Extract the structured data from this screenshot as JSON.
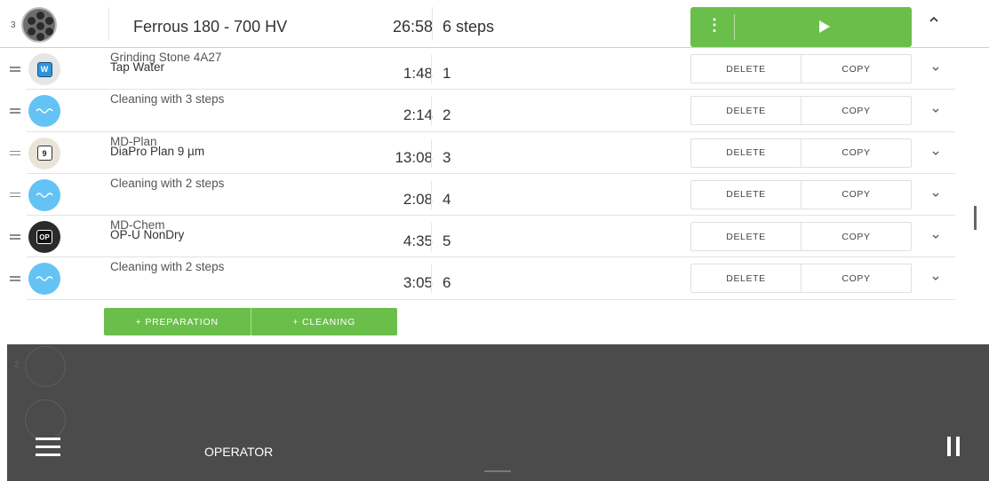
{
  "header": {
    "holder_number": "3",
    "title": "Ferrous 180 - 700 HV",
    "total_time": "26:58",
    "step_count": "6 steps",
    "kebab_glyph": "⋮",
    "run_color": "#6abf4b"
  },
  "steps": [
    {
      "line1": "Grinding Stone 4A27",
      "line2": "Tap Water",
      "time": "1:48",
      "number": "1",
      "icon": "water-grinding-icon",
      "badge": "W"
    },
    {
      "line1": "Cleaning with 3 steps",
      "line2": "",
      "time": "2:14",
      "number": "2",
      "icon": "cleaning-wave-icon",
      "badge": ""
    },
    {
      "line1": "MD-Plan",
      "line2": "DiaPro Plan 9 µm",
      "time": "13:08",
      "number": "3",
      "icon": "diamond-9-icon",
      "badge": "9"
    },
    {
      "line1": "Cleaning with 2 steps",
      "line2": "",
      "time": "2:08",
      "number": "4",
      "icon": "cleaning-wave-icon",
      "badge": ""
    },
    {
      "line1": "MD-Chem",
      "line2": "OP-U NonDry",
      "time": "4:35",
      "number": "5",
      "icon": "op-polishing-icon",
      "badge": "OP"
    },
    {
      "line1": "Cleaning with 2 steps",
      "line2": "",
      "time": "3:05",
      "number": "6",
      "icon": "cleaning-wave-icon",
      "badge": ""
    }
  ],
  "step_actions": {
    "delete_label": "DELETE",
    "copy_label": "COPY"
  },
  "add_buttons": {
    "preparation_label": "+ PREPARATION",
    "cleaning_label": "+ CLEANING"
  },
  "bottom_bar": {
    "ghost_number": "2",
    "operator_label": "OPERATOR"
  }
}
